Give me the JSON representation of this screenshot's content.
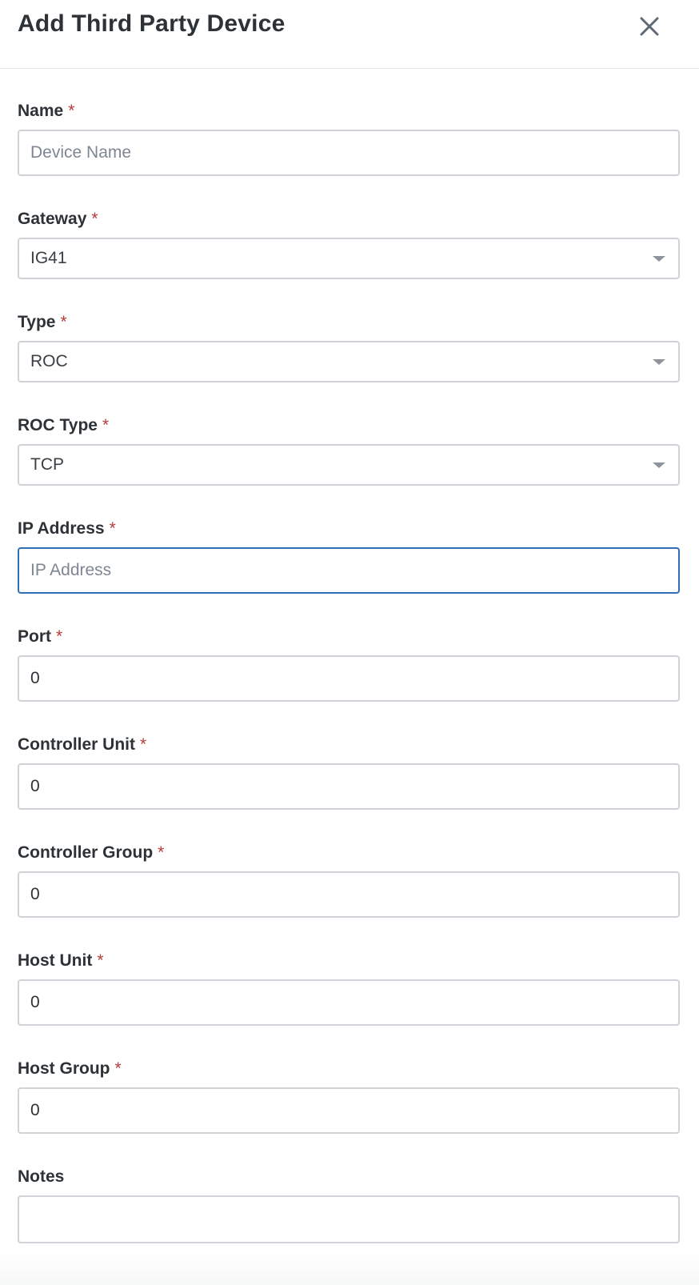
{
  "dialog": {
    "title": "Add Third Party Device",
    "close_icon": "close-icon"
  },
  "required_marker": "*",
  "fields": {
    "name": {
      "label": "Name",
      "value": "",
      "placeholder": "Device Name",
      "required": true
    },
    "gateway": {
      "label": "Gateway",
      "value": "IG41",
      "required": true
    },
    "type": {
      "label": "Type",
      "value": "ROC",
      "required": true
    },
    "roc_type": {
      "label": "ROC Type",
      "value": "TCP",
      "required": true
    },
    "ip_address": {
      "label": "IP Address",
      "value": "",
      "placeholder": "IP Address",
      "required": true,
      "focused": true
    },
    "port": {
      "label": "Port",
      "value": "0",
      "required": true
    },
    "controller_unit": {
      "label": "Controller Unit",
      "value": "0",
      "required": true
    },
    "controller_group": {
      "label": "Controller Group",
      "value": "0",
      "required": true
    },
    "host_unit": {
      "label": "Host Unit",
      "value": "0",
      "required": true
    },
    "host_group": {
      "label": "Host Group",
      "value": "0",
      "required": true
    },
    "notes": {
      "label": "Notes",
      "value": "",
      "required": false
    }
  },
  "colors": {
    "required": "#b83a3a",
    "focus_border": "#2f6fb8",
    "input_border": "#cfd3d8"
  }
}
